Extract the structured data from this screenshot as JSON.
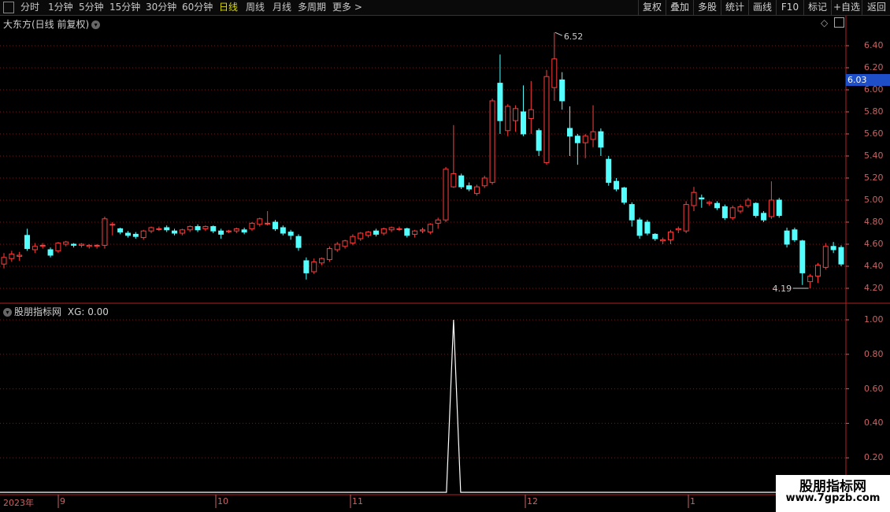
{
  "toolbar": {
    "items": [
      "分时",
      "1分钟",
      "5分钟",
      "15分钟",
      "30分钟",
      "60分钟",
      "日线",
      "周线",
      "月线",
      "多周期",
      "更多 >"
    ],
    "active": "日线",
    "right": [
      "复权",
      "叠加",
      "多股",
      "统计",
      "画线",
      "F10",
      "标记",
      "+自选",
      "返回"
    ]
  },
  "main_title": "大东方(日线 前复权)",
  "indicator_title": "股朋指标网",
  "indicator_value": "XG: 0.00",
  "price_axis": [
    "6.40",
    "6.20",
    "6.00",
    "5.80",
    "5.60",
    "5.40",
    "5.20",
    "5.00",
    "4.80",
    "4.60",
    "4.40",
    "4.20"
  ],
  "indicator_axis": [
    "1.00",
    "0.80",
    "0.60",
    "0.40",
    "0.20"
  ],
  "current_price": "6.03",
  "high_label": "6.52",
  "low_label": "4.19",
  "date_axis": [
    "2023年",
    "9",
    "10",
    "11",
    "12",
    "1"
  ],
  "watermark": {
    "line1": "股朋指标网",
    "line2": "www.7gpzb.com"
  },
  "colors": {
    "up": "#ff3c3c",
    "down": "#54ffff",
    "grid": "#7a1a1a",
    "axis": "#c86464"
  },
  "chart_data": {
    "type": "candlestick",
    "ylim": [
      4.1,
      6.55
    ],
    "candles": [
      [
        4.42,
        4.48,
        4.38,
        4.52
      ],
      [
        4.47,
        4.51,
        4.44,
        4.54
      ],
      [
        4.49,
        4.5,
        4.45,
        4.53
      ],
      [
        4.68,
        4.56,
        4.54,
        4.74
      ],
      [
        4.55,
        4.58,
        4.52,
        4.61
      ],
      [
        4.59,
        4.59,
        4.56,
        4.61
      ],
      [
        4.55,
        4.5,
        4.48,
        4.57
      ],
      [
        4.54,
        4.61,
        4.52,
        4.62
      ],
      [
        4.6,
        4.62,
        4.58,
        4.63
      ],
      [
        4.6,
        4.59,
        4.57,
        4.61
      ],
      [
        4.59,
        4.6,
        4.57,
        4.61
      ],
      [
        4.58,
        4.59,
        4.56,
        4.6
      ],
      [
        4.59,
        4.59,
        4.56,
        4.6
      ],
      [
        4.59,
        4.83,
        4.56,
        4.85
      ],
      [
        4.78,
        4.78,
        4.68,
        4.8
      ],
      [
        4.74,
        4.71,
        4.69,
        4.75
      ],
      [
        4.7,
        4.68,
        4.66,
        4.72
      ],
      [
        4.69,
        4.67,
        4.65,
        4.71
      ],
      [
        4.66,
        4.72,
        4.64,
        4.73
      ],
      [
        4.72,
        4.75,
        4.7,
        4.76
      ],
      [
        4.74,
        4.74,
        4.72,
        4.76
      ],
      [
        4.75,
        4.73,
        4.71,
        4.77
      ],
      [
        4.72,
        4.7,
        4.68,
        4.74
      ],
      [
        4.7,
        4.73,
        4.68,
        4.74
      ],
      [
        4.73,
        4.76,
        4.71,
        4.77
      ],
      [
        4.76,
        4.73,
        4.71,
        4.78
      ],
      [
        4.74,
        4.76,
        4.72,
        4.77
      ],
      [
        4.76,
        4.72,
        4.7,
        4.77
      ],
      [
        4.72,
        4.69,
        4.65,
        4.74
      ],
      [
        4.72,
        4.72,
        4.7,
        4.73
      ],
      [
        4.72,
        4.74,
        4.7,
        4.75
      ],
      [
        4.73,
        4.71,
        4.69,
        4.75
      ],
      [
        4.74,
        4.79,
        4.72,
        4.8
      ],
      [
        4.78,
        4.83,
        4.76,
        4.84
      ],
      [
        4.79,
        4.79,
        4.77,
        4.9
      ],
      [
        4.8,
        4.74,
        4.72,
        4.82
      ],
      [
        4.75,
        4.7,
        4.68,
        4.77
      ],
      [
        4.71,
        4.68,
        4.64,
        4.73
      ],
      [
        4.67,
        4.57,
        4.54,
        4.69
      ],
      [
        4.45,
        4.34,
        4.28,
        4.48
      ],
      [
        4.35,
        4.44,
        4.33,
        4.47
      ],
      [
        4.43,
        4.47,
        4.41,
        4.48
      ],
      [
        4.46,
        4.56,
        4.44,
        4.58
      ],
      [
        4.55,
        4.6,
        4.53,
        4.62
      ],
      [
        4.58,
        4.63,
        4.56,
        4.64
      ],
      [
        4.61,
        4.67,
        4.59,
        4.69
      ],
      [
        4.65,
        4.7,
        4.63,
        4.71
      ],
      [
        4.68,
        4.71,
        4.66,
        4.72
      ],
      [
        4.72,
        4.69,
        4.67,
        4.74
      ],
      [
        4.7,
        4.74,
        4.68,
        4.75
      ],
      [
        4.73,
        4.75,
        4.71,
        4.76
      ],
      [
        4.74,
        4.74,
        4.72,
        4.76
      ],
      [
        4.74,
        4.68,
        4.66,
        4.75
      ],
      [
        4.69,
        4.72,
        4.66,
        4.73
      ],
      [
        4.72,
        4.73,
        4.7,
        4.75
      ],
      [
        4.71,
        4.78,
        4.69,
        4.79
      ],
      [
        4.79,
        4.82,
        4.74,
        4.84
      ],
      [
        4.82,
        5.28,
        4.8,
        5.3
      ],
      [
        5.12,
        5.24,
        5.11,
        5.68
      ],
      [
        5.22,
        5.12,
        5.1,
        5.24
      ],
      [
        5.13,
        5.1,
        5.08,
        5.16
      ],
      [
        5.06,
        5.12,
        5.04,
        5.14
      ],
      [
        5.13,
        5.2,
        5.11,
        5.22
      ],
      [
        5.16,
        5.9,
        5.14,
        5.92
      ],
      [
        6.06,
        5.72,
        5.6,
        6.32
      ],
      [
        5.63,
        5.85,
        5.58,
        5.87
      ],
      [
        5.72,
        5.83,
        5.62,
        5.86
      ],
      [
        5.8,
        5.6,
        5.58,
        6.04
      ],
      [
        5.74,
        5.82,
        5.6,
        6.08
      ],
      [
        5.63,
        5.45,
        5.4,
        5.65
      ],
      [
        5.34,
        6.12,
        5.32,
        6.18
      ],
      [
        6.02,
        6.28,
        5.9,
        6.52
      ],
      [
        6.09,
        5.9,
        5.82,
        6.16
      ],
      [
        5.65,
        5.58,
        5.4,
        5.85
      ],
      [
        5.58,
        5.52,
        5.32,
        5.6
      ],
      [
        5.52,
        5.58,
        5.38,
        5.6
      ],
      [
        5.55,
        5.62,
        5.48,
        5.86
      ],
      [
        5.62,
        5.48,
        5.4,
        5.65
      ],
      [
        5.37,
        5.16,
        5.13,
        5.4
      ],
      [
        5.17,
        5.1,
        5.08,
        5.2
      ],
      [
        5.11,
        4.98,
        4.96,
        5.12
      ],
      [
        4.96,
        4.82,
        4.76,
        4.98
      ],
      [
        4.82,
        4.68,
        4.65,
        4.84
      ],
      [
        4.8,
        4.7,
        4.68,
        4.82
      ],
      [
        4.69,
        4.65,
        4.63,
        4.7
      ],
      [
        4.63,
        4.64,
        4.6,
        4.66
      ],
      [
        4.64,
        4.71,
        4.6,
        4.73
      ],
      [
        4.73,
        4.74,
        4.7,
        4.76
      ],
      [
        4.72,
        4.96,
        4.7,
        4.99
      ],
      [
        4.95,
        5.07,
        4.9,
        5.12
      ],
      [
        5.02,
        5.01,
        4.93,
        5.05
      ],
      [
        4.97,
        4.98,
        4.95,
        4.99
      ],
      [
        4.97,
        4.93,
        4.91,
        4.99
      ],
      [
        4.94,
        4.84,
        4.82,
        4.96
      ],
      [
        4.84,
        4.93,
        4.82,
        4.95
      ],
      [
        4.9,
        4.94,
        4.88,
        4.96
      ],
      [
        4.95,
        5.0,
        4.93,
        5.02
      ],
      [
        4.97,
        4.86,
        4.84,
        4.98
      ],
      [
        4.88,
        4.82,
        4.8,
        4.9
      ],
      [
        4.85,
        5.0,
        4.83,
        5.17
      ],
      [
        5.0,
        4.86,
        4.84,
        5.02
      ],
      [
        4.72,
        4.6,
        4.57,
        4.75
      ],
      [
        4.73,
        4.64,
        4.62,
        4.75
      ],
      [
        4.63,
        4.34,
        4.23,
        4.64
      ],
      [
        4.26,
        4.31,
        4.2,
        4.33
      ],
      [
        4.31,
        4.41,
        4.25,
        4.43
      ],
      [
        4.39,
        4.58,
        4.37,
        4.61
      ],
      [
        4.58,
        4.55,
        4.52,
        4.62
      ],
      [
        4.57,
        4.42,
        4.4,
        4.59
      ]
    ],
    "signal": {
      "index": 58,
      "value": 1.0
    },
    "indicator_ylim": [
      0,
      1.05
    ]
  }
}
